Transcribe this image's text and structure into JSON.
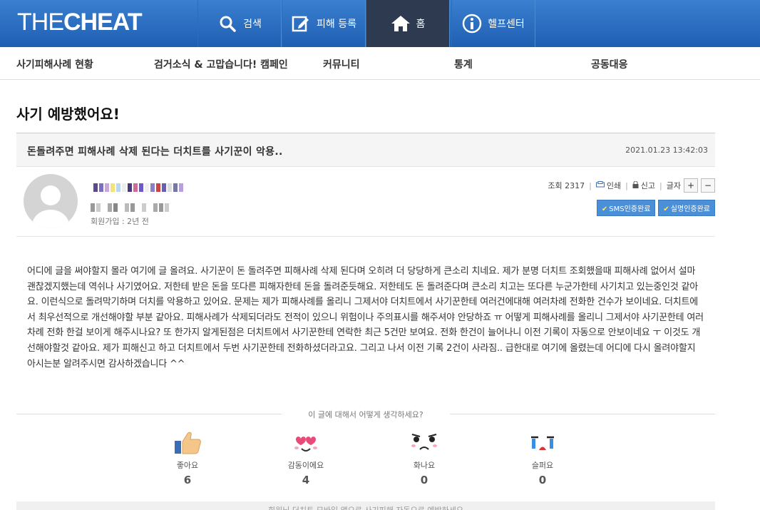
{
  "header": {
    "logo_light": "THE",
    "logo_bold": "CHEAT",
    "nav": [
      {
        "label": "검색",
        "icon": "search-icon"
      },
      {
        "label": "피해 등록",
        "icon": "edit-icon"
      },
      {
        "label": "홈",
        "icon": "home-icon"
      },
      {
        "label": "헬프센터",
        "icon": "info-icon"
      }
    ]
  },
  "subnav": [
    "사기피해사례 현황",
    "검거소식 & 고맙습니다! 캠페인",
    "커뮤니티",
    "통계",
    "공동대응"
  ],
  "page_title": "사기 예방했어요!",
  "post": {
    "title": "돈돌려주면 피해사례 삭제 된다는 더치트를 사기꾼이 악용..",
    "date": "2021.01.23 13:42:03",
    "joined": "회원가입 : 2년 전",
    "views_label": "조회",
    "views": "2317",
    "print": "인쇄",
    "report": "신고",
    "font_label": "글자",
    "font_plus": "+",
    "font_minus": "−",
    "badges": [
      "SMS인증완료",
      "실명인증완료"
    ],
    "body": "어디에 글을 써야할지 몰라 여기에 글 올려요. 사기꾼이 돈 돌려주면 피해사례 삭제 된다며 오히려 더 당당하게 큰소리 치네요. 제가 분명 더치트 조회했을때 피해사례 없어서 설마 괜찮겠지했는데 역쉬나 사기였어요. 저한테 받은 돈을 또다른 피해자한테 돈을 돌려준듯해요. 저한테도 돈 돌려준다며 큰소리 치고는 또다른 누군가한테 사기치고 있는중인것 같아요. 이런식으로 돌려막기하며 더치를 악용하고 있어요. 문제는 제가 피해사례를 올리니 그제서야 더치트에서 사기꾼한테 여러건에대해 여러차례 전화한 건수가 보이네요. 더치트에서 최우선적으로 개선해야할 부분 같아요. 피해사례가 삭제되더라도 전적이 있으니 위험이나 주의표시를 해주셔야 안당하죠 ㅠ 어떻게 피해사례를 올리니 그제서야 사기꾼한테 여러차례 전화 한걸 보이게 해주시나요? 또 한가지 알게된점은 더치트에서 사기꾼한테 연락한 최근 5건만 보여요. 전화 한건이 늘어나니 이전 기록이 자동으로 안보이네요 ㅜ 이것도 개선해야할것 같아요. 제가 피해신고 하고 더치트에서 두번 사기꾼한테 전화하셨더라고요. 그리고 나서 이전 기록 2건이 사라짐.. 급한대로 여기에 올렸는데 어디에 다시 올려야할지 아시는분 알려주시면 감사하겠습니다 ^^"
  },
  "feedback": {
    "question": "이 글에 대해서 어떻게 생각하세요?",
    "reactions": [
      {
        "label": "좋아요",
        "count": "6",
        "icon": "thumbs-up-icon"
      },
      {
        "label": "감동이에요",
        "count": "4",
        "icon": "heart-eyes-icon"
      },
      {
        "label": "화나요",
        "count": "0",
        "icon": "angry-face-icon"
      },
      {
        "label": "슬퍼요",
        "count": "0",
        "icon": "crying-face-icon"
      }
    ]
  },
  "footer_note": "회원님 더치트 모바일 앱으로 사기피해 자동으로 예방하세요"
}
